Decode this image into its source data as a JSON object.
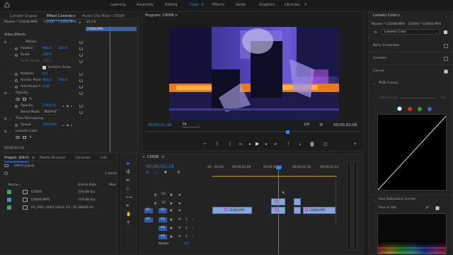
{
  "top_menu": {
    "items": [
      "Learning",
      "Assembly",
      "Editing",
      "Color",
      "Effects",
      "Audio",
      "Graphics",
      "Libraries"
    ],
    "active": "Color"
  },
  "source_panel": {
    "tabs": [
      "Lumetri Scopes",
      "Effect Controls",
      "Audio Clip Mixer: C0008"
    ],
    "master_label": "Master * C0008.MP4",
    "sequence_label": "C0008 * C0008.MP4",
    "mini_timecode": "01;14",
    "mini_clip": "C0008.MP4",
    "video_effects": "Video Effects",
    "rows": [
      {
        "label": "Motion",
        "value": "",
        "value2": ""
      },
      {
        "label": "Position",
        "value": "960,0",
        "value2": "540,0"
      },
      {
        "label": "Scale",
        "value": "100,0",
        "value2": ""
      },
      {
        "label": "Scale Width",
        "value": "100,0",
        "value2": ""
      },
      {
        "label": "Uniform Scale",
        "value": "",
        "value2": ""
      },
      {
        "label": "Rotation",
        "value": "0,0",
        "value2": ""
      },
      {
        "label": "Anchor Point",
        "value": "960,0",
        "value2": "540,0"
      },
      {
        "label": "Anti-flicker F...",
        "value": "0,00",
        "value2": ""
      },
      {
        "label": "Opacity",
        "value": "",
        "value2": ""
      },
      {
        "label": "Opacity",
        "value": "100,0 %",
        "value2": ""
      },
      {
        "label": "Blend Mode",
        "value": "Normal",
        "value2": ""
      },
      {
        "label": "Time Remapping",
        "value": "",
        "value2": ""
      },
      {
        "label": "Speed",
        "value": "100,00%",
        "value2": ""
      },
      {
        "label": "Lumetri Color",
        "value": "",
        "value2": ""
      }
    ],
    "bottom_timecode": "00;00;01;16"
  },
  "program_monitor": {
    "title": "Program: C0008",
    "timecode": "00;00;01;16",
    "fit": "Fit",
    "resolution": "1/4",
    "duration": "00;00;02;09"
  },
  "project_panel": {
    "tabs": [
      "Project: Glitch",
      "Media Browser",
      "Libraries",
      "Info"
    ],
    "file": "Glitch.prproj",
    "items_count": "3 Items",
    "headers": [
      "Name",
      "Frame Rate",
      "Med"
    ],
    "rows": [
      {
        "name": "C0008",
        "rate": "119,88 fps",
        "color": "#33a86a"
      },
      {
        "name": "C0008.MP4",
        "rate": "119,88 fps",
        "color": "#4c86c8"
      },
      {
        "name": "ES_PXEL SSFX Glitch 13 - SF",
        "rate": "48000 Hz",
        "color": "#33a86a"
      }
    ]
  },
  "timeline": {
    "sequence": "C0008",
    "timecode": "00;00;01;16",
    "ruler": [
      ";00",
      ";01;04",
      "00;00;01;09",
      "00;00;01;14",
      "00;00;01;19",
      "00;00;01;24"
    ],
    "tracks": [
      "V3",
      "V2",
      "V1",
      "A1",
      "A2",
      "A3"
    ],
    "track_left": [
      "",
      "",
      "V1",
      "A1",
      "",
      ""
    ],
    "master_label": "Master",
    "master_value": "0,0",
    "clips": [
      "C0008.MP4",
      "C0008.MP4"
    ]
  },
  "lumetri": {
    "title": "Lumetri Color",
    "master_label": "Master * C0008.MP4",
    "sequence_label": "C0008 * C0008.MP4",
    "fx_label": "Lumetri Color",
    "sections": [
      "Basic Correction",
      "Creative",
      "Curves",
      "RGB Curves"
    ],
    "hdr_range": "HDR Range",
    "hdr_value": "100",
    "hue_section": "Hue Saturation Curves",
    "hue_vs_sat": "Hue vs Sat",
    "swatches": [
      "#ffffff",
      "#d9312b",
      "#2f9e3d",
      "#3f66d6"
    ]
  }
}
